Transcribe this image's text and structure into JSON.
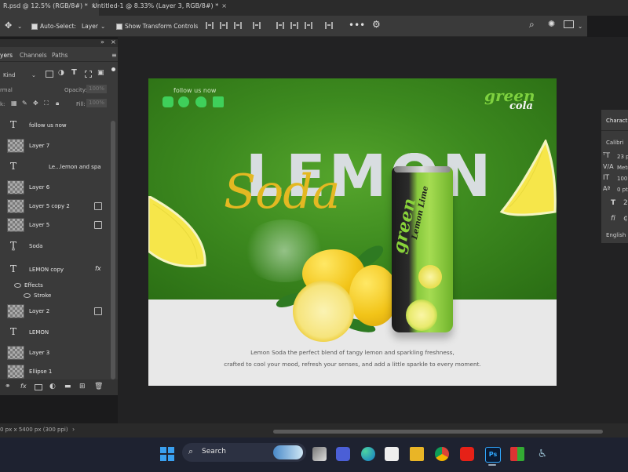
{
  "tabs": [
    {
      "label": "R.psd @ 12.5% (RGB/8#) *",
      "close": "×",
      "active": true
    },
    {
      "label": "Untitled-1 @ 8.33% (Layer 3, RGB/8#) *",
      "close": "×",
      "active": false
    }
  ],
  "options_bar": {
    "auto_select_label": "Auto-Select:",
    "target": "Layer",
    "show_transform_label": "Show Transform Controls",
    "more": "•••"
  },
  "layers_panel": {
    "tabs": [
      "yers",
      "Channels",
      "Paths"
    ],
    "filter_kind": "Kind",
    "blend_mode": "rmal",
    "opacity_label": "Opacity:",
    "opacity_value": "100%",
    "lock_label": "k:",
    "fill_label": "Fill:",
    "fill_value": "100%",
    "layers": [
      {
        "name": "follow us now",
        "kind": "text"
      },
      {
        "name": "Layer 7",
        "kind": "image"
      },
      {
        "name": "Le...lemon and spa",
        "kind": "text"
      },
      {
        "name": "Layer 6",
        "kind": "image"
      },
      {
        "name": "Layer 5 copy 2",
        "kind": "image",
        "linked": true
      },
      {
        "name": "Layer 5",
        "kind": "image",
        "linked": true
      },
      {
        "name": "Soda",
        "kind": "warp-text"
      },
      {
        "name": "LEMON copy",
        "kind": "text",
        "fx": "fx"
      },
      {
        "name": "Effects",
        "kind": "effect"
      },
      {
        "name": "Stroke",
        "kind": "effect"
      },
      {
        "name": "Layer 2",
        "kind": "image",
        "linked": true
      },
      {
        "name": "LEMON",
        "kind": "text"
      },
      {
        "name": "Layer 3",
        "kind": "image"
      },
      {
        "name": "Ellipse 1",
        "kind": "shape"
      }
    ]
  },
  "canvas": {
    "follow": "follow us now",
    "headline": "LEMON",
    "script": "Soda",
    "brand_top": "green",
    "brand_bottom": "cola",
    "can_brand": "green",
    "can_flavor": "Lemon Lime",
    "desc_line1": "Lemon Soda  the perfect blend of tangy lemon and sparkling freshness,",
    "desc_line2": "crafted to cool your mood, refresh your senses, and add a little sparkle to every moment."
  },
  "character_panel": {
    "title": "Charact",
    "font": "Calibri",
    "size": "23 p",
    "kerning": "Metr",
    "scale": "100",
    "baseline": "0 pt",
    "lang": "English"
  },
  "status": {
    "doc_size": "0 px x 5400 px (300 ppi)"
  },
  "taskbar": {
    "search": "Search"
  },
  "colors": {
    "canvas_green": "#3d8a1f",
    "soda_gold": "#e4b822",
    "brand_green": "#7ed13f"
  }
}
